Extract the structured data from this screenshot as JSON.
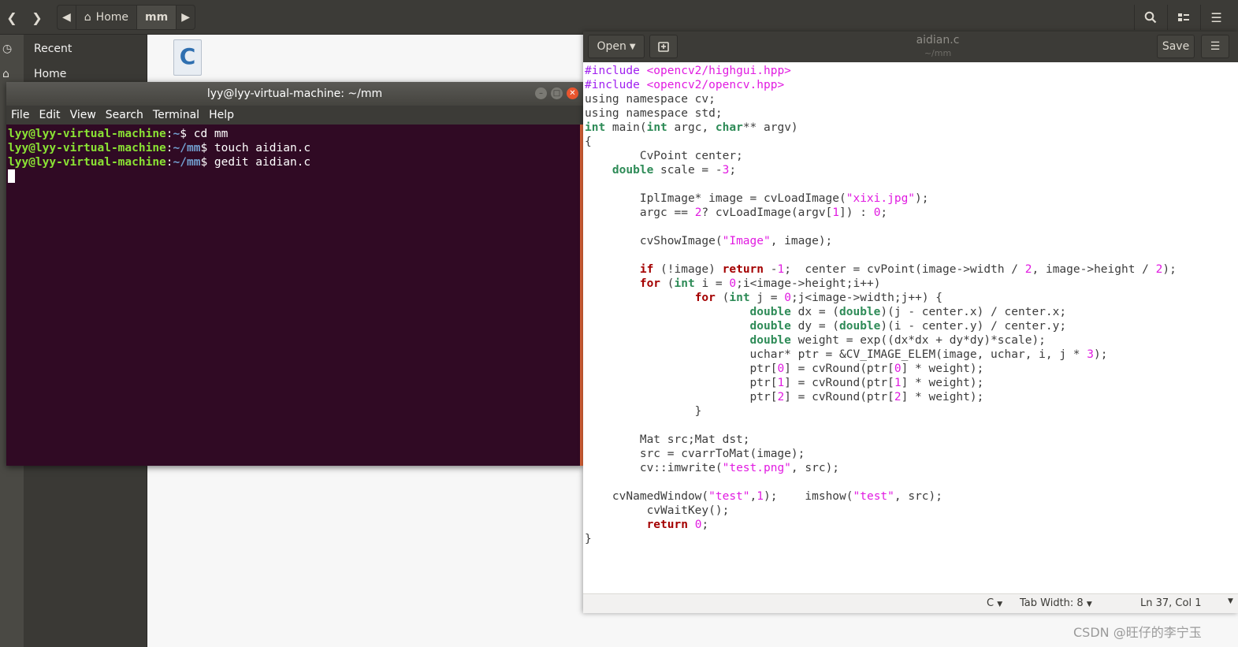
{
  "file_manager": {
    "breadcrumb": {
      "home_label": "Home",
      "current_label": "mm"
    },
    "sidebar": {
      "items": [
        {
          "label": "Recent"
        },
        {
          "label": "Home"
        }
      ]
    },
    "file": {
      "name": "aidian.c",
      "icon": "c-source-file-icon"
    }
  },
  "terminal": {
    "title": "lyy@lyy-virtual-machine: ~/mm",
    "menu": [
      "File",
      "Edit",
      "View",
      "Search",
      "Terminal",
      "Help"
    ],
    "lines": [
      {
        "user": "lyy@lyy-virtual-machine",
        "path": "~",
        "cmd": "cd mm"
      },
      {
        "user": "lyy@lyy-virtual-machine",
        "path": "~/mm",
        "cmd": "touch aidian.c"
      },
      {
        "user": "lyy@lyy-virtual-machine",
        "path": "~/mm",
        "cmd": "gedit aidian.c"
      }
    ]
  },
  "gedit": {
    "open_label": "Open",
    "title": "aidian.c",
    "subtitle": "~/mm",
    "save_label": "Save",
    "status": {
      "language": "C",
      "tab_width": "Tab Width: 8",
      "position": "Ln 37, Col 1"
    },
    "code": [
      "#include <opencv2/highgui.hpp>",
      "#include <opencv2/opencv.hpp>",
      "using namespace cv;",
      "using namespace std;",
      "int main(int argc, char** argv)",
      "{",
      "        CvPoint center;",
      "    double scale = -3;",
      "",
      "        IplImage* image = cvLoadImage(\"xixi.jpg\");",
      "        argc == 2? cvLoadImage(argv[1]) : 0;",
      "",
      "        cvShowImage(\"Image\", image);",
      "",
      "        if (!image) return -1;  center = cvPoint(image->width / 2, image->height / 2);",
      "        for (int i = 0;i<image->height;i++)",
      "                for (int j = 0;j<image->width;j++) {",
      "                        double dx = (double)(j - center.x) / center.x;",
      "                        double dy = (double)(i - center.y) / center.y;",
      "                        double weight = exp((dx*dx + dy*dy)*scale);",
      "                        uchar* ptr = &CV_IMAGE_ELEM(image, uchar, i, j * 3);",
      "                        ptr[0] = cvRound(ptr[0] * weight);",
      "                        ptr[1] = cvRound(ptr[1] * weight);",
      "                        ptr[2] = cvRound(ptr[2] * weight);",
      "                }",
      "",
      "        Mat src;Mat dst;",
      "        src = cvarrToMat(image);",
      "        cv::imwrite(\"test.png\", src);",
      "",
      "    cvNamedWindow(\"test\",1);    imshow(\"test\", src);",
      "         cvWaitKey();",
      "         return 0;",
      "}"
    ]
  },
  "watermark": "CSDN @旺仔的李宁玉",
  "colors": {
    "terminal_bg": "#300a24",
    "prompt_user": "#8ae234",
    "prompt_path": "#729fcf",
    "close_button": "#e9552e"
  }
}
